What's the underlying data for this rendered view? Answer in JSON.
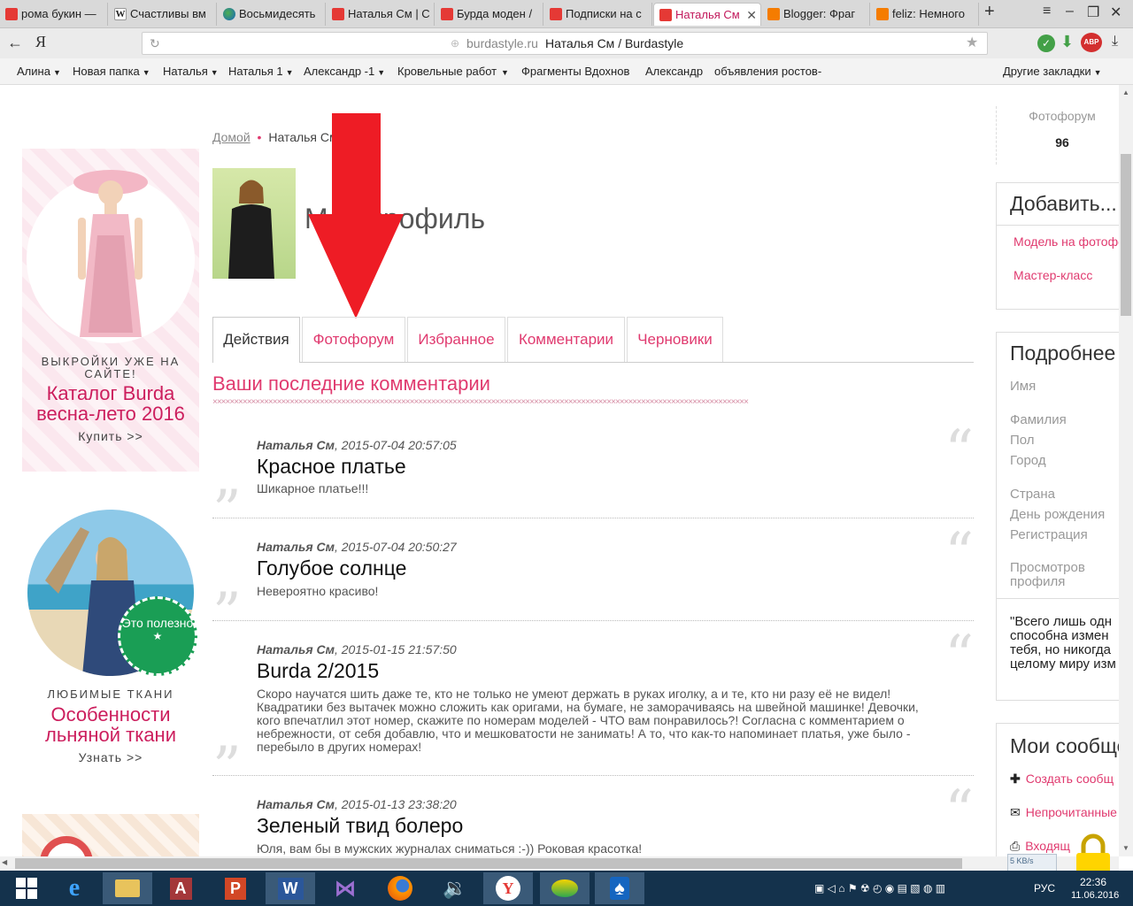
{
  "browser": {
    "tabs": [
      {
        "title": "рома букин —",
        "color": "#e53935"
      },
      {
        "title": "Счастливы вм",
        "color": "#ffffff",
        "glyph": "W"
      },
      {
        "title": "Восьмидесять",
        "color": "#2e7d32"
      },
      {
        "title": "Наталья См | С",
        "color": "#e53935"
      },
      {
        "title": "Бурда моден /",
        "color": "#e53935"
      },
      {
        "title": "Подписки на с",
        "color": "#e53935"
      },
      {
        "title": "Наталья См",
        "color": "#e53935",
        "active": true
      },
      {
        "title": "Blogger: Фраг",
        "color": "#f57c00"
      },
      {
        "title": "feliz: Немного",
        "color": "#f57c00"
      }
    ],
    "new_tab": "+",
    "url_host": "burdastyle.ru",
    "url_title": "Наталья См / Burdastyle",
    "yandex_logo": "Я",
    "adblock_badge": "ABP",
    "bookmarks": [
      {
        "label": "Алина",
        "dd": true
      },
      {
        "label": "Новая папка",
        "dd": true
      },
      {
        "label": "Наталья",
        "dd": true
      },
      {
        "label": "Наталья 1",
        "dd": true
      },
      {
        "label": "Александр -1",
        "dd": true
      },
      {
        "label": "Кровельные работ",
        "dd": true
      },
      {
        "label": "Фрагменты Вдохнов",
        "dd": false
      },
      {
        "label": "Александр",
        "dd": false
      },
      {
        "label": "объявления ростов-",
        "dd": false
      }
    ],
    "other_bookmarks": "Другие закладки"
  },
  "left_ads": {
    "ad1_kicker": "ВЫКРОЙКИ УЖЕ НА САЙТЕ!",
    "ad1_title": "Каталог Burda весна-лето 2016",
    "ad1_cta": "Купить >>",
    "ad2_badge": "Это полезно",
    "ad2_kicker": "ЛЮБИМЫЕ ТКАНИ",
    "ad2_title": "Особенности льняной ткани",
    "ad2_cta": "Узнать >>"
  },
  "breadcrumb": {
    "home": "Домой",
    "sep": "•",
    "current": "Наталья См"
  },
  "profile": {
    "title": "Мой профиль"
  },
  "tabs": [
    "Действия",
    "Фотофорум",
    "Избранное",
    "Комментарии",
    "Черновики"
  ],
  "section_title": "Ваши последние комментарии",
  "comments": [
    {
      "author": "Наталья См",
      "date": ", 2015-07-04 20:57:05",
      "title": "Красное платье",
      "text": "Шикарное платье!!!"
    },
    {
      "author": "Наталья См",
      "date": ", 2015-07-04 20:50:27",
      "title": "Голубое солнце",
      "text": "Невероятно красиво!"
    },
    {
      "author": "Наталья См",
      "date": ", 2015-01-15 21:57:50",
      "title": "Burda 2/2015",
      "text": "Скоро научатся шить даже те, кто не только не умеют держать в руках иголку, а и те, кто ни разу её не видел! Квадратики без вытачек можно сложить как оригами, на бумаге, не заморачиваясь на швейной машинке! Девочки, кого впечатлил этот номер, скажите по номерам моделей - ЧТО вам понравилось?! Согласна с комментарием о небрежности, от себя добавлю, что и мешковатости не занимать! А то, что как-то напоминает платья, уже было - перебыло в других номерах!"
    },
    {
      "author": "Наталья См",
      "date": ", 2015-01-13 23:38:20",
      "title": "Зеленый твид болеро",
      "text": "Юля, вам бы в мужских журналах сниматься :-)) Роковая красотка!"
    }
  ],
  "right": {
    "stat_label": "Фотофорум",
    "stat_value": "96",
    "add_title": "Добавить...",
    "add_links": [
      "Модель на фотофо",
      "Мастер-класс"
    ],
    "details_title": "Подробнее",
    "details_fields": [
      "Имя",
      "Фамилия",
      "Пол",
      "Город",
      "Страна",
      "День рождения",
      "Регистрация",
      "Просмотров профиля"
    ],
    "quote": "\"Всего лишь одн способна измен тебя, но никогда целому миру изм",
    "messages_title": "Мои сообще",
    "messages_links": [
      "Создать сообщ",
      "Непрочитанные",
      "Входящ"
    ]
  },
  "taskbar": {
    "lang": "РУС",
    "time": "22:36",
    "date": "11.06.2016",
    "net_speed": "5 KB/s"
  },
  "colors": {
    "accent": "#e03a6f",
    "ad_title": "#cc1e5d",
    "arrow": "#ee1c25",
    "badge": "#1a9e55"
  }
}
